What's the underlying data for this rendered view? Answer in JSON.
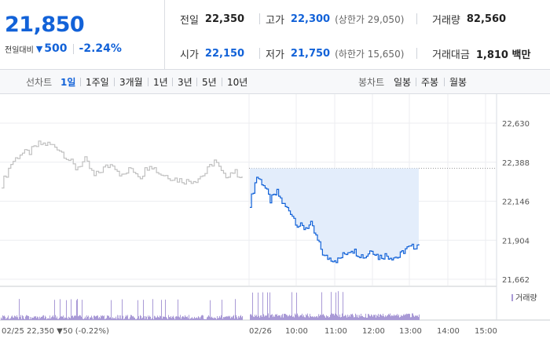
{
  "summary": {
    "price": "21,850",
    "change_label": "전일대비",
    "change_value": "500",
    "change_pct": "-2.24%",
    "prev_close": {
      "label": "전일",
      "value": "22,350"
    },
    "high": {
      "label": "고가",
      "value": "22,300",
      "note": "(상한가 29,050)"
    },
    "volume": {
      "label": "거래량",
      "value": "82,560"
    },
    "open": {
      "label": "시가",
      "value": "22,150"
    },
    "low": {
      "label": "저가",
      "value": "21,750",
      "note": "(하한가 15,650)"
    },
    "amount": {
      "label": "거래대금",
      "value": "1,810 백만"
    }
  },
  "periods": {
    "label": "선차트",
    "items": [
      "1일",
      "1주일",
      "3개월",
      "1년",
      "3년",
      "5년",
      "10년"
    ],
    "active": "1일"
  },
  "candles": {
    "label": "봉차트",
    "items": [
      "일봉",
      "주봉",
      "월봉"
    ]
  },
  "colors": {
    "up": "#e0262b",
    "down": "#1262d8",
    "prev_day_line": "#c0c0c0",
    "fill": "#e3edfb",
    "volume": "#a99ad6"
  },
  "chart_data": {
    "type": "line",
    "y_ticks": [
      "22,630",
      "22,388",
      "22,146",
      "21,904",
      "21,662"
    ],
    "y_tick_values": [
      22630,
      22388,
      22146,
      21904,
      21662
    ],
    "ylim": [
      21662,
      22630
    ],
    "x_ticks": [
      "02/25",
      "02/26",
      "10:00",
      "11:00",
      "12:00",
      "13:00",
      "14:00",
      "15:00"
    ],
    "prev_close_value": 22350,
    "prev_day_note": "22,350 ▼50 (-0.22%)",
    "volume_legend": "거래량",
    "series": [
      {
        "period": "02/25",
        "x": [
          "09:00",
          "09:15",
          "09:30",
          "09:45",
          "10:00",
          "10:15",
          "10:30",
          "10:45",
          "11:00",
          "11:15",
          "11:30",
          "11:45",
          "12:00",
          "12:15",
          "12:30",
          "12:45",
          "13:00",
          "13:15",
          "13:30",
          "13:45",
          "14:00",
          "14:15",
          "14:30",
          "14:45",
          "15:00",
          "15:15",
          "15:30"
        ],
        "values": [
          22250,
          22380,
          22440,
          22450,
          22500,
          22500,
          22480,
          22420,
          22350,
          22400,
          22300,
          22350,
          22380,
          22300,
          22350,
          22300,
          22380,
          22320,
          22300,
          22280,
          22270,
          22280,
          22320,
          22400,
          22300,
          22330,
          22300
        ]
      },
      {
        "period": "02/26",
        "x": [
          "09:00",
          "09:05",
          "09:10",
          "09:15",
          "09:20",
          "09:25",
          "09:30",
          "09:40",
          "09:50",
          "10:00",
          "10:10",
          "10:20",
          "10:30",
          "10:40",
          "10:50",
          "11:00",
          "11:15",
          "11:30",
          "11:45",
          "12:00",
          "12:15",
          "12:30",
          "12:45",
          "13:00",
          "13:15",
          "13:25"
        ],
        "values": [
          22130,
          22300,
          22250,
          22150,
          22200,
          22120,
          22080,
          22000,
          21980,
          22000,
          21900,
          21800,
          21790,
          21780,
          21820,
          21850,
          21820,
          21800,
          21850,
          21800,
          21810,
          21800,
          21800,
          21850,
          21860,
          21880
        ]
      }
    ]
  }
}
